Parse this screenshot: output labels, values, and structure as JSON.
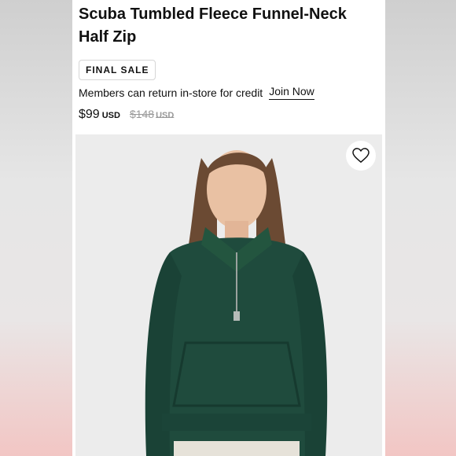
{
  "product": {
    "title": "Scuba Tumbled Fleece Funnel-Neck Half Zip",
    "badge": "FINAL SALE",
    "members_text": "Members can return in-store for credit",
    "join_link": "Join Now",
    "price_now": "$99",
    "price_now_currency": "USD",
    "price_was": "$148",
    "price_was_currency": "USD"
  },
  "icons": {
    "heart": "heart-icon"
  },
  "colors": {
    "sweater": "#1f4b3d",
    "photo_bg": "#ebebeb"
  }
}
